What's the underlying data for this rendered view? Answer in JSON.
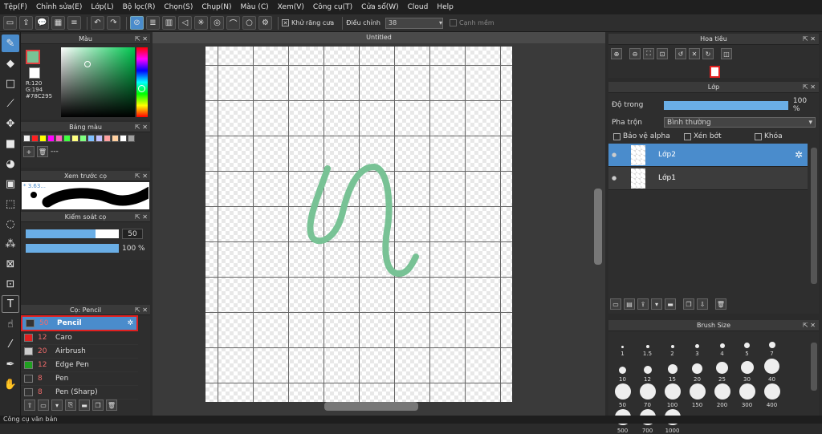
{
  "menu": [
    "Tệp(F)",
    "Chỉnh sửa(E)",
    "Lớp(L)",
    "Bộ lọc(R)",
    "Chọn(S)",
    "Chụp(N)",
    "Màu (C)",
    "Xem(V)",
    "Công cụ(T)",
    "Cửa sổ(W)",
    "Cloud",
    "Help"
  ],
  "toolbar": {
    "antialias_label": "Khử răng cưa",
    "adjust_label": "Điều chỉnh",
    "adjust_value": "38",
    "smooth_label": "Cạnh mềm"
  },
  "color_panel": {
    "title": "Màu",
    "r": "R:120",
    "g": "G:194",
    "hex": "#78C295",
    "main_color": "#78C295"
  },
  "palette_panel": {
    "title": "Bảng màu",
    "dash": "---",
    "swatches": [
      "#f0f0f0",
      "#ff2020",
      "#ffff00",
      "#ff00ff",
      "#ff60c0",
      "#40ff40",
      "#ffff80",
      "#80ff80",
      "#80c0ff",
      "#c0c0ff",
      "#ffa0a0",
      "#ffd0a0",
      "#ffffff",
      "#a0a0a0"
    ]
  },
  "brush_preview": {
    "title": "Xem trước cọ",
    "size_label": "* 3.63..."
  },
  "brush_control": {
    "title": "Kiểm soát cọ",
    "size_value": "50",
    "opacity_value": "100 %",
    "size_fraction": 0.75,
    "opacity_fraction": 1.0
  },
  "brush_list": {
    "title": "Cọ: Pencil",
    "items": [
      {
        "size": "50",
        "name": "Pencil",
        "color": "#333333",
        "selected": true
      },
      {
        "size": "12",
        "name": "Caro",
        "color": "#e02020"
      },
      {
        "size": "20",
        "name": "Airbrush",
        "color": "#cccccc"
      },
      {
        "size": "12",
        "name": "Edge Pen",
        "color": "#20a020"
      },
      {
        "size": "8",
        "name": "Pen",
        "color": "#333333"
      },
      {
        "size": "8",
        "name": "Pen (Sharp)",
        "color": "#333333"
      }
    ]
  },
  "document": {
    "title": "Untitled"
  },
  "navigator": {
    "title": "Hoa tiêu"
  },
  "layers": {
    "title": "Lớp",
    "opacity_label": "Độ trong",
    "opacity_value": "100 %",
    "opacity_fraction": 1.0,
    "blend_label": "Pha trộn",
    "blend_value": "Bình thường",
    "protect_alpha": "Bảo vệ alpha",
    "clip": "Xén bớt",
    "lock": "Khóa",
    "items": [
      {
        "name": "Lớp2",
        "selected": true
      },
      {
        "name": "Lớp1",
        "selected": false
      }
    ]
  },
  "brush_size": {
    "title": "Brush Size",
    "sizes": [
      "1",
      "1.5",
      "2",
      "3",
      "4",
      "5",
      "7",
      "10",
      "12",
      "15",
      "20",
      "25",
      "30",
      "40",
      "50",
      "70",
      "100",
      "150",
      "200",
      "300",
      "400",
      "500",
      "700",
      "1000"
    ]
  },
  "status": "Công cụ văn bản"
}
